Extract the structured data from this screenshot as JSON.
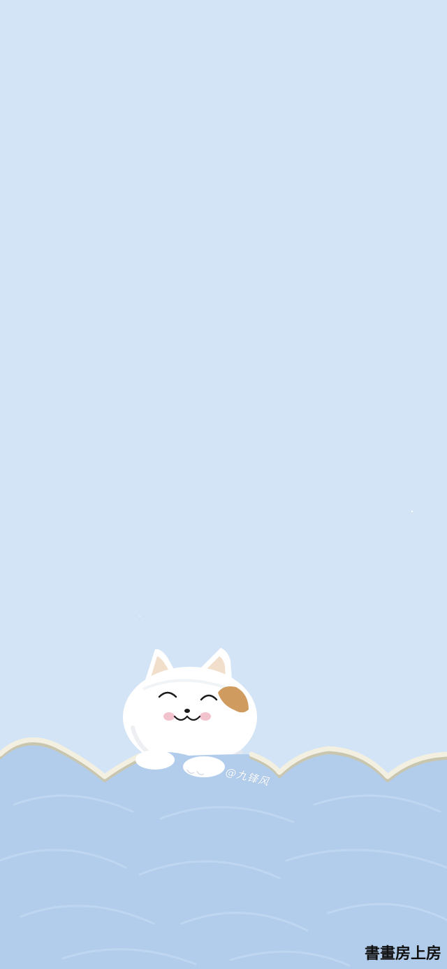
{
  "scene": {
    "subject": "cat-peeking-over-wave",
    "colors": {
      "sky": "#d2e4f6",
      "water": "#b2cdeb",
      "water_stroke": "#c3d9f1",
      "wave_outline": "#f3f0e2",
      "wave_outline_shadow": "#c9c6b0",
      "cat_fur": "#ffffff",
      "cat_shadow": "#e5e8ee",
      "cat_ear_inner": "#efd9c2",
      "cat_patch": "#cf9b5e",
      "cat_cheeks": "#f2c3cc",
      "cat_features": "#1b1b1b"
    }
  },
  "artist_credit": "@九锋风",
  "watermark": "書畫房上房"
}
